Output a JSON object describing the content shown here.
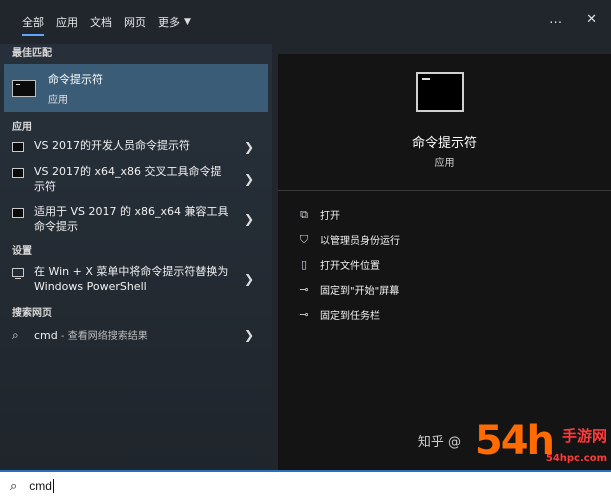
{
  "tabs": [
    {
      "label": "全部"
    },
    {
      "label": "应用"
    },
    {
      "label": "文档"
    },
    {
      "label": "网页"
    },
    {
      "label": "更多"
    }
  ],
  "topbar": {
    "more_icon": "…",
    "close_icon": "✕"
  },
  "left": {
    "best_match_header": "最佳匹配",
    "best_match": {
      "title": "命令提示符",
      "type": "应用"
    },
    "apps_header": "应用",
    "apps": [
      {
        "label": "VS 2017的开发人员命令提示符"
      },
      {
        "label": "VS 2017的 x64_x86 交叉工具命令提示符"
      },
      {
        "label": "适用于 VS 2017 的 x86_x64 兼容工具命令提示"
      }
    ],
    "settings_header": "设置",
    "settings": [
      {
        "label": "在 Win + X 菜单中将命令提示符替换为 Windows PowerShell"
      }
    ],
    "web_header": "搜索网页",
    "web": [
      {
        "label": "cmd",
        "sub": " - 查看网络搜索结果"
      }
    ]
  },
  "detail": {
    "title": "命令提示符",
    "type": "应用",
    "actions": [
      {
        "icon": "open-icon",
        "label": "打开"
      },
      {
        "icon": "shield-icon",
        "label": "以管理员身份运行"
      },
      {
        "icon": "file-location-icon",
        "label": "打开文件位置"
      },
      {
        "icon": "pin-start-icon",
        "label": "固定到\"开始\"屏幕"
      },
      {
        "icon": "pin-taskbar-icon",
        "label": "固定到任务栏"
      }
    ]
  },
  "watermark": {
    "zhihu": "知乎 @",
    "logo": "54h",
    "site": "手游网",
    "url": "54hpc.com"
  },
  "search": {
    "value": "cmd"
  },
  "colors": {
    "accent": "#60a5fa",
    "selected": "#3b5c77",
    "detail_bg": "#141414"
  }
}
